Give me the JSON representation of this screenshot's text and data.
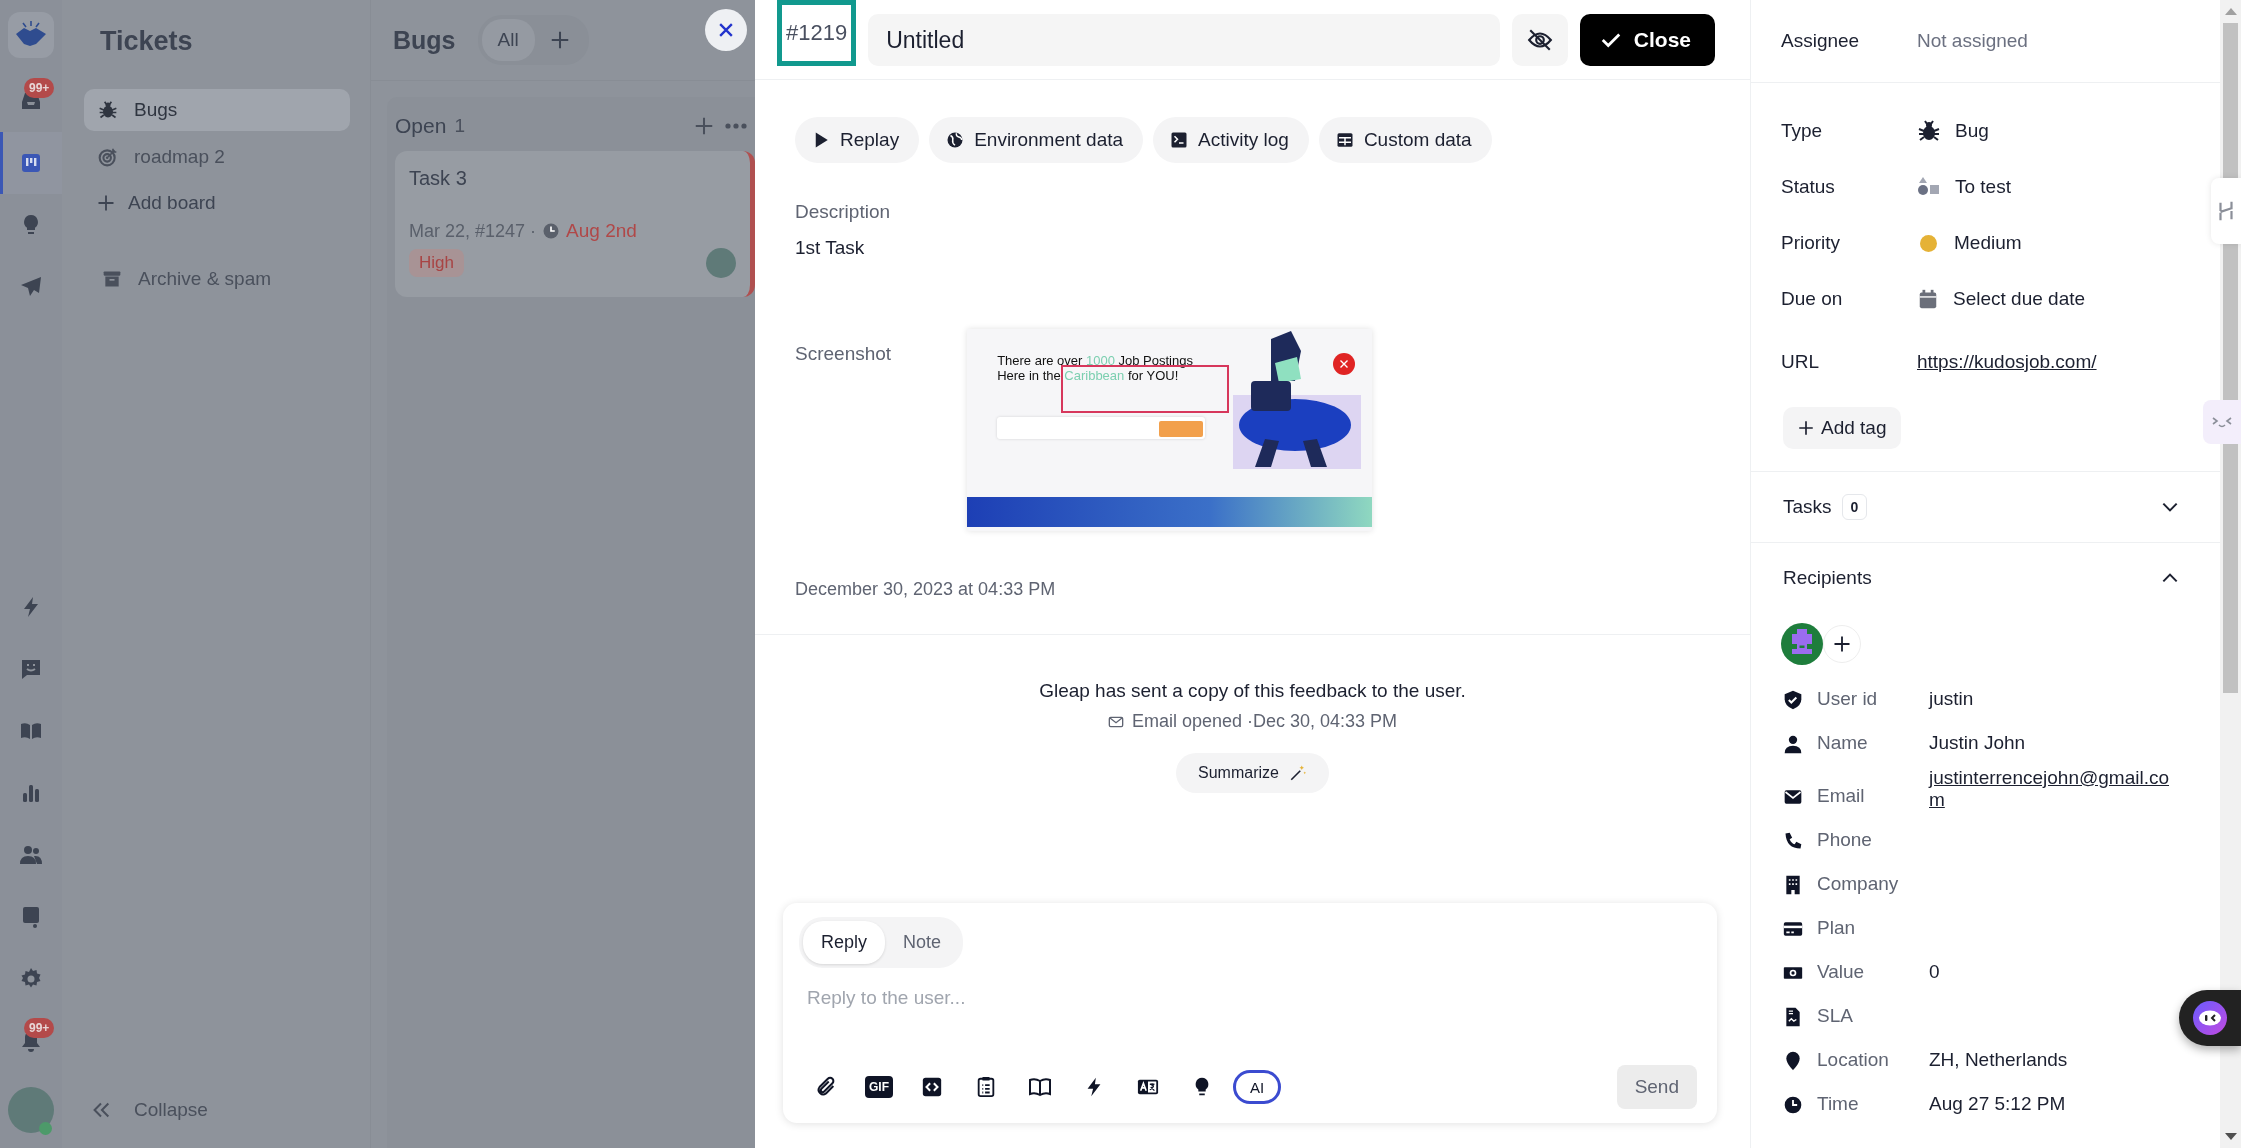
{
  "nav_rail": {
    "top_items": [
      {
        "kind": "inbox",
        "badge": "99+",
        "selected": false
      },
      {
        "kind": "board",
        "selected": true
      },
      {
        "kind": "bulb",
        "selected": false
      },
      {
        "kind": "send",
        "selected": false
      }
    ],
    "bottom_items": [
      {
        "kind": "bolt",
        "selected": false
      },
      {
        "kind": "chat",
        "selected": false
      },
      {
        "kind": "book",
        "selected": false
      },
      {
        "kind": "chart",
        "selected": false
      },
      {
        "kind": "people",
        "selected": false
      },
      {
        "kind": "feedback",
        "selected": false
      },
      {
        "kind": "gear",
        "selected": false
      },
      {
        "kind": "bell",
        "badge": "99+",
        "selected": false
      }
    ]
  },
  "sidebar": {
    "title": "Tickets",
    "boards": [
      {
        "label": "Bugs",
        "kind": "bug",
        "selected": true
      },
      {
        "label": "roadmap 2",
        "kind": "target",
        "selected": false
      }
    ],
    "add_board": "Add board",
    "archive": "Archive & spam",
    "collapse": "Collapse"
  },
  "board": {
    "title": "Bugs",
    "filter": "All",
    "column": {
      "title": "Open",
      "count": "1",
      "cards": [
        {
          "title": "Task 3",
          "meta": "Mar 22, #1247 ·",
          "due": "Aug 2nd",
          "tag": "High"
        }
      ]
    }
  },
  "ticket": {
    "id": "#1219",
    "title": "Untitled",
    "close": "Close",
    "actions": [
      {
        "kind": "play",
        "label": "Replay"
      },
      {
        "kind": "globe",
        "label": "Environment data"
      },
      {
        "kind": "terminal",
        "label": "Activity log"
      },
      {
        "kind": "table",
        "label": "Custom data"
      }
    ],
    "description_label": "Description",
    "description": "1st Task",
    "screenshot_label": "Screenshot",
    "screenshot": {
      "headline": [
        [
          {
            "text": "There are over ",
            "highlight": false
          },
          {
            "text": "1000",
            "highlight": true
          },
          {
            "text": " Job Postings",
            "highlight": false
          }
        ],
        [
          {
            "text": "Here in the ",
            "highlight": false
          },
          {
            "text": "Caribbean",
            "highlight": true
          },
          {
            "text": " for YOU!",
            "highlight": false
          }
        ]
      ]
    },
    "date": "December 30, 2023 at 04:33 PM",
    "message": "Gleap has sent a copy of this feedback to the user.",
    "email_status": "Email opened ·Dec 30, 04:33 PM",
    "summarize": "Summarize",
    "composer": {
      "tabs": [
        {
          "label": "Reply",
          "selected": true
        },
        {
          "label": "Note",
          "selected": false
        }
      ],
      "placeholder": "Reply to the user...",
      "tools": [
        {
          "kind": "attach"
        },
        {
          "kind": "gif",
          "label": "GIF"
        },
        {
          "kind": "code"
        },
        {
          "kind": "clipboard"
        },
        {
          "kind": "book"
        },
        {
          "kind": "bolt"
        },
        {
          "kind": "translate"
        },
        {
          "kind": "bulb"
        },
        {
          "kind": "ai",
          "label": "AI"
        }
      ],
      "send": "Send"
    }
  },
  "details": {
    "assignee": {
      "label": "Assignee",
      "value": "Not assigned"
    },
    "properties": [
      {
        "label": "Type",
        "kind": "bug",
        "value": "Bug"
      },
      {
        "label": "Status",
        "kind": "status",
        "value": "To test"
      },
      {
        "label": "Priority",
        "kind": "dot",
        "value": "Medium",
        "color": "#e5b236"
      },
      {
        "label": "Due on",
        "kind": "calendar",
        "value": "Select due date"
      }
    ],
    "url": {
      "label": "URL",
      "value": "https://kudosjob.com/"
    },
    "add_tag": "Add tag",
    "tasks": {
      "label": "Tasks",
      "count": "0",
      "expanded": false
    },
    "recipients": {
      "label": "Recipients",
      "expanded": true
    },
    "contact_fields": [
      {
        "kind": "shield",
        "label": "User id",
        "value": "justin"
      },
      {
        "kind": "person",
        "label": "Name",
        "value": "Justin John"
      },
      {
        "kind": "mail",
        "label": "Email",
        "value": "justinterrencejohn@gmail.com",
        "link": true
      },
      {
        "kind": "phone",
        "label": "Phone"
      },
      {
        "kind": "building",
        "label": "Company"
      },
      {
        "kind": "card",
        "label": "Plan"
      },
      {
        "kind": "money",
        "label": "Value",
        "value": "0"
      },
      {
        "kind": "file",
        "label": "SLA"
      },
      {
        "kind": "pin",
        "label": "Location",
        "value": "ZH, Netherlands"
      },
      {
        "kind": "clock",
        "label": "Time",
        "value": "Aug 27 5:12 PM"
      }
    ]
  }
}
